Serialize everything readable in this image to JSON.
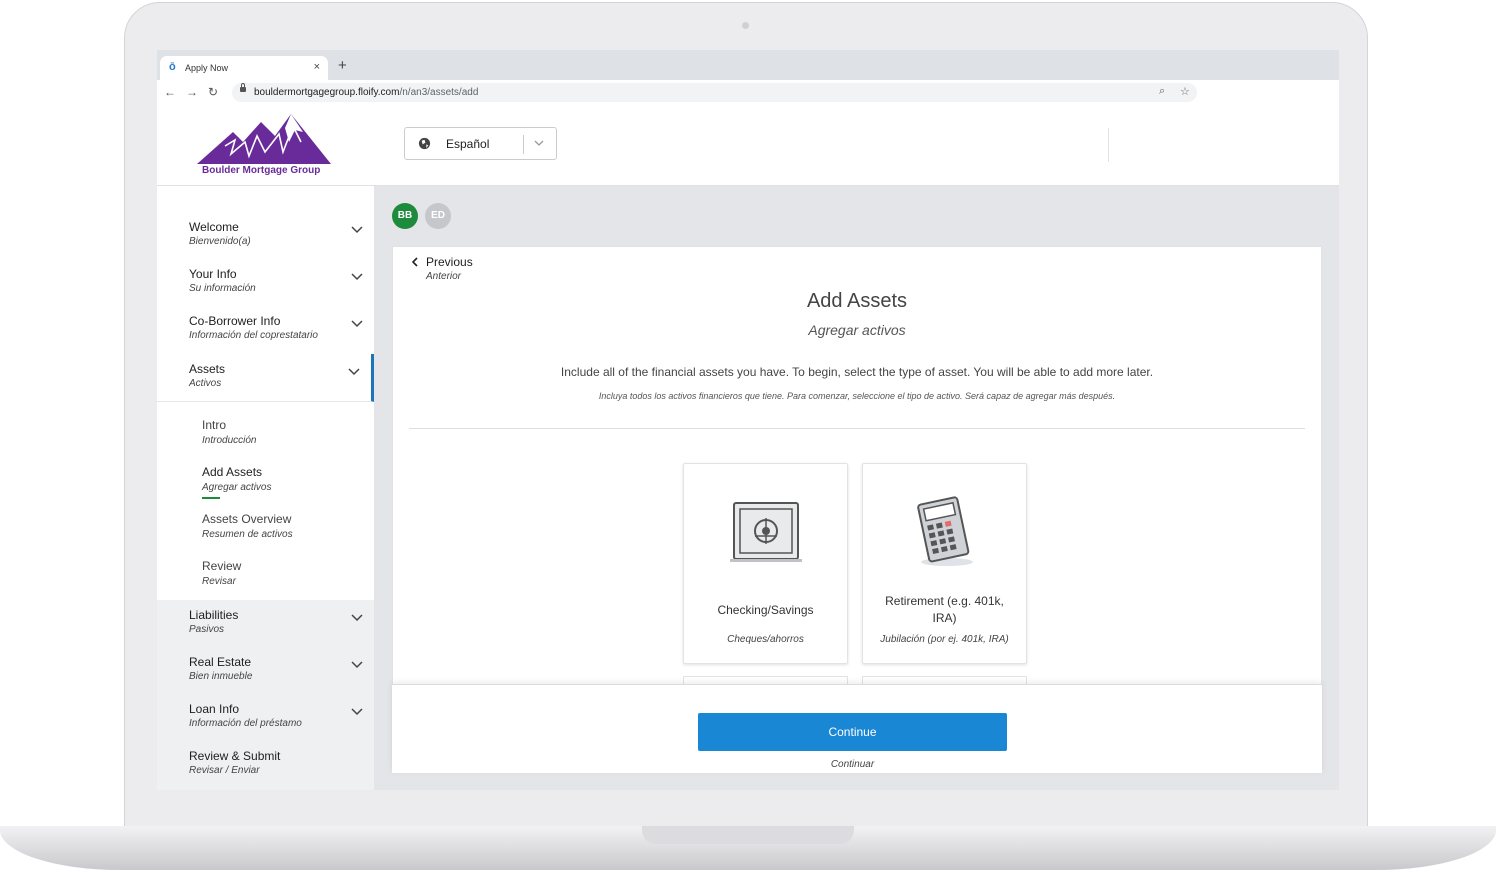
{
  "browser": {
    "tab_title": "Apply Now",
    "tab_close": "×",
    "new_tab": "+",
    "url_host": "bouldermortgagegroup.floify.com",
    "url_path": "/n/an3/assets/add"
  },
  "header": {
    "logo_text": "Boulder Mortgage Group",
    "language_label": "Español",
    "brand_color": "#6a2b9a"
  },
  "sidebar": {
    "items": [
      {
        "en": "Welcome",
        "es": "Bienvenido(a)"
      },
      {
        "en": "Your Info",
        "es": "Su información"
      },
      {
        "en": "Co-Borrower Info",
        "es": "Información del coprestatario"
      },
      {
        "en": "Assets",
        "es": "Activos"
      },
      {
        "en": "Liabilities",
        "es": "Pasivos"
      },
      {
        "en": "Real Estate",
        "es": "Bien inmueble"
      },
      {
        "en": "Loan Info",
        "es": "Información del préstamo"
      },
      {
        "en": "Review & Submit",
        "es": "Revisar / Enviar"
      }
    ],
    "sub_items": [
      {
        "en": "Intro",
        "es": "Introducción"
      },
      {
        "en": "Add Assets",
        "es": "Agregar activos"
      },
      {
        "en": "Assets Overview",
        "es": "Resumen de activos"
      },
      {
        "en": "Review",
        "es": "Revisar"
      }
    ],
    "active_color": "#1b75bc"
  },
  "avatars": [
    {
      "initials": "BB",
      "color": "#1e8a3c"
    },
    {
      "initials": "ED",
      "color": "#c5c7cb"
    }
  ],
  "main": {
    "previous_en": "Previous",
    "previous_es": "Anterior",
    "title": "Add Assets",
    "subtitle": "Agregar activos",
    "intro_en": "Include all of the financial assets you have. To begin, select the type of asset. You will be able to add more later.",
    "intro_es": "Incluya todos los activos financieros que tiene. Para comenzar, seleccione el tipo de activo. Será capaz de agregar más después.",
    "asset_types": [
      {
        "en": "Checking/Savings",
        "es": "Cheques/ahorros",
        "icon": "safe-icon"
      },
      {
        "en_line1": "Retirement (e.g. 401k,",
        "en_line2": "IRA)",
        "es": "Jubilación (por ej. 401k, IRA)",
        "icon": "calculator-icon"
      }
    ],
    "continue_en": "Continue",
    "continue_es": "Continuar",
    "button_color": "#1a87d4"
  }
}
